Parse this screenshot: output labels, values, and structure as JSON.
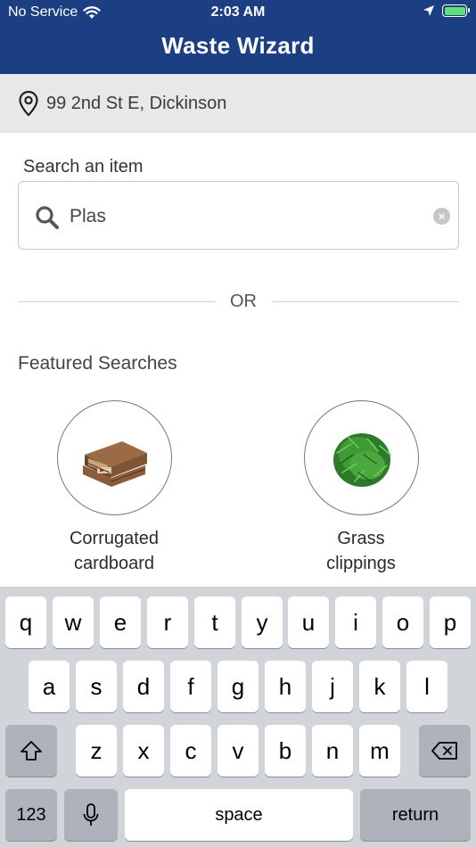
{
  "status_bar": {
    "carrier": "No Service",
    "time": "2:03 AM"
  },
  "header": {
    "title": "Waste Wizard",
    "background_color": "#1c3f84"
  },
  "address": {
    "text": "99 2nd St E, Dickinson",
    "icon": "location-pin-icon"
  },
  "search": {
    "label": "Search an item",
    "value": "Plas",
    "icon": "search-icon"
  },
  "divider": {
    "text": "OR"
  },
  "featured": {
    "title": "Featured Searches",
    "items": [
      {
        "label_line1": "Corrugated",
        "label_line2": "cardboard",
        "image": "cardboard-image"
      },
      {
        "label_line1": "Grass",
        "label_line2": "clippings",
        "image": "grass-image"
      }
    ]
  },
  "keyboard": {
    "row1": [
      "q",
      "w",
      "e",
      "r",
      "t",
      "y",
      "u",
      "i",
      "o",
      "p"
    ],
    "row2": [
      "a",
      "s",
      "d",
      "f",
      "g",
      "h",
      "j",
      "k",
      "l"
    ],
    "row3": [
      "z",
      "x",
      "c",
      "v",
      "b",
      "n",
      "m"
    ],
    "numbers_key": "123",
    "space_key": "space",
    "return_key": "return"
  }
}
